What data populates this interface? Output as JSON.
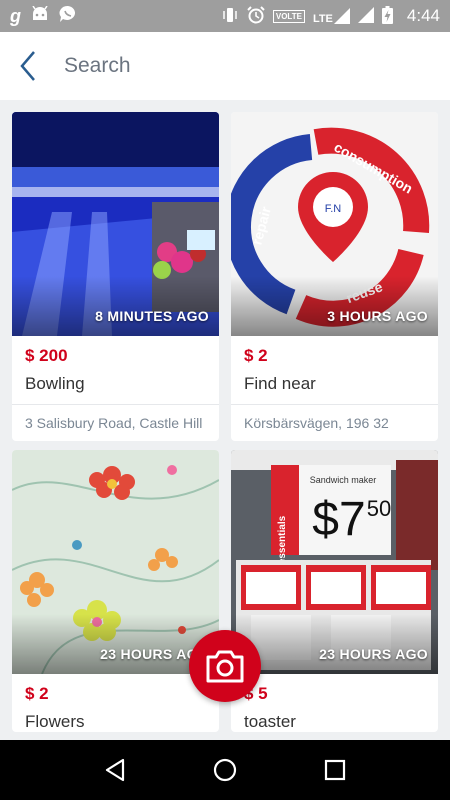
{
  "status_bar": {
    "time": "4:44",
    "volte": "VOLTE",
    "lte": "LTE",
    "icons": [
      "g-icon",
      "android-icon",
      "chat-icon",
      "vibrate-icon",
      "alarm-icon",
      "signal-icon",
      "battery-charging-icon"
    ]
  },
  "header": {
    "back_icon": "chevron-left-icon",
    "title": "Search"
  },
  "listings": [
    {
      "time_ago": "8 MINUTES AGO",
      "price": "$ 200",
      "title": "Bowling",
      "location": "3 Salisbury Road, Castle Hill"
    },
    {
      "time_ago": "3 HOURS AGO",
      "price": "$ 2",
      "title": "Find near",
      "location": "Körsbärsvägen, 196 32"
    },
    {
      "time_ago": "23 HOURS AGO",
      "price": "$ 2",
      "title": "Flowers",
      "location": ""
    },
    {
      "time_ago": "23 HOURS AGO",
      "price": "$ 5",
      "title": "toaster",
      "location": ""
    }
  ],
  "images": {
    "find_near_logo": {
      "top": "consumption",
      "left": "repair",
      "bottom": "reuse",
      "center": "F.N"
    },
    "toaster_sign": {
      "top": "Sandwich maker",
      "brand": "essentials",
      "price": "$7",
      "cents": "50"
    }
  },
  "fab": {
    "icon": "camera-icon"
  },
  "nav": {
    "icons": [
      "back-triangle-icon",
      "home-circle-icon",
      "recents-square-icon"
    ]
  },
  "colors": {
    "accent": "#d0021b",
    "status_bar": "#9e9e9e",
    "background": "#eef0f2"
  }
}
